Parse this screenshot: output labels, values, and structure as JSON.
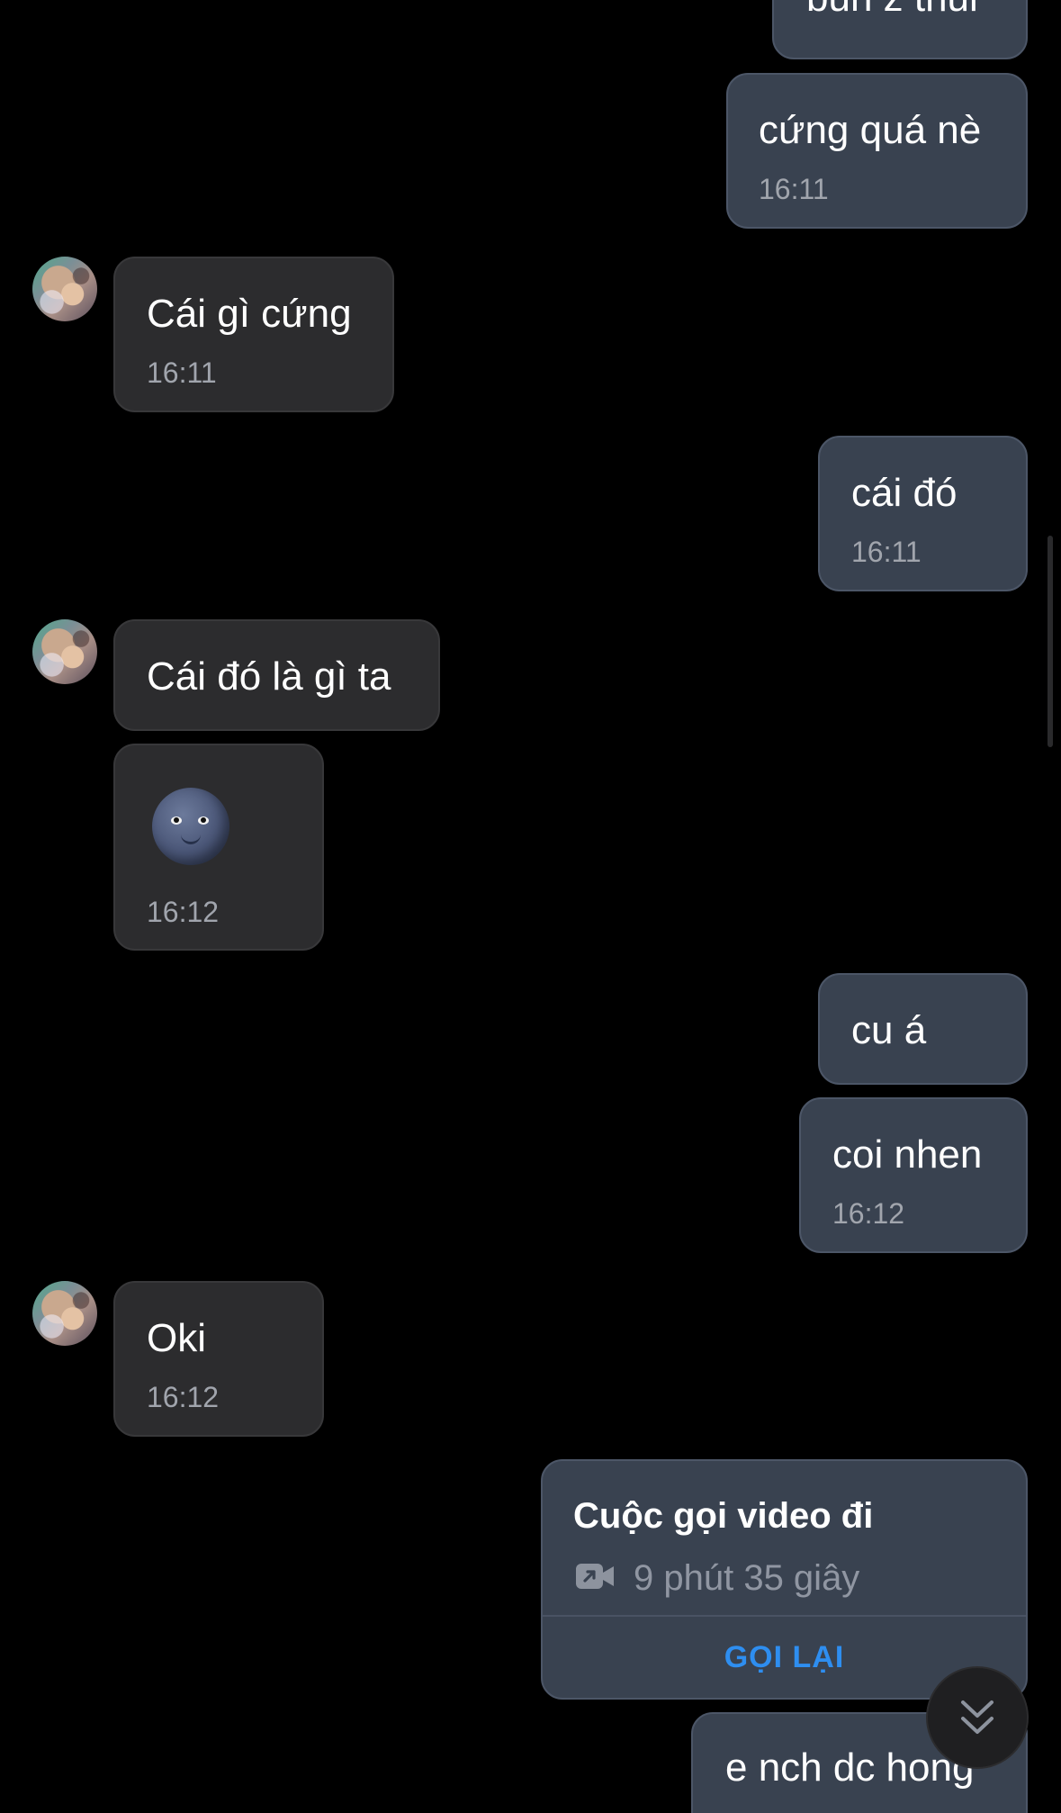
{
  "messages": [
    {
      "text": "bun z thui",
      "time": ""
    },
    {
      "text": "cứng quá nè",
      "time": "16:11"
    },
    {
      "text": "Cái gì cứng",
      "time": "16:11"
    },
    {
      "text": "cái đó",
      "time": "16:11"
    },
    {
      "text": "Cái đó là gì ta",
      "time": ""
    },
    {
      "text": "",
      "emoji": "new-moon-face",
      "time": "16:12"
    },
    {
      "text": "cu á",
      "time": ""
    },
    {
      "text": "coi nhen",
      "time": "16:12"
    },
    {
      "text": "Oki",
      "time": "16:12"
    },
    {
      "text": "e nch dc hong",
      "time": ""
    }
  ],
  "call": {
    "title": "Cuộc gọi video đi",
    "duration": "9 phút 35 giây",
    "action": "GỌI LẠI",
    "icon": "video-camera-icon"
  },
  "scroll_button": {
    "icon": "double-chevron-down-icon"
  },
  "colors": {
    "outgoing_bubble": "#394250",
    "incoming_bubble": "#2c2c2e",
    "accent": "#2e8ef0",
    "background": "#000000"
  }
}
